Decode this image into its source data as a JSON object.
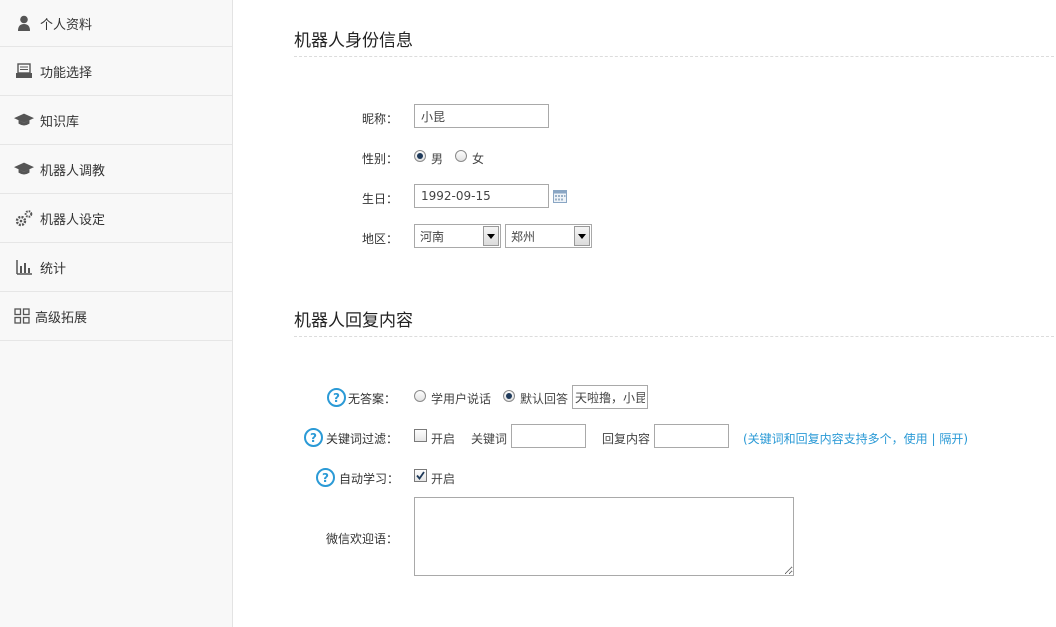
{
  "sidebar": {
    "items": [
      {
        "label": "个人资料",
        "icon": "user-icon"
      },
      {
        "label": "功能选择",
        "icon": "tray-icon"
      },
      {
        "label": "知识库",
        "icon": "graduation-cap-icon"
      },
      {
        "label": "机器人调教",
        "icon": "graduation-cap-icon"
      },
      {
        "label": "机器人设定",
        "icon": "gears-icon"
      },
      {
        "label": "统计",
        "icon": "bar-chart-icon"
      },
      {
        "label": "高级拓展",
        "icon": "grid-icon"
      }
    ]
  },
  "identity": {
    "title": "机器人身份信息",
    "nickname_label": "昵称：",
    "nickname_value": "小昆",
    "gender_label": "性别：",
    "gender_male": "男",
    "gender_female": "女",
    "gender_selected": "男",
    "birthday_label": "生日：",
    "birthday_value": "1992-09-15",
    "region_label": "地区：",
    "province": "河南",
    "city": "郑州"
  },
  "reply": {
    "title": "机器人回复内容",
    "no_answer_label": "无答案：",
    "learn_user_option": "学用户说话",
    "default_reply_option": "默认回答",
    "default_reply_value": "天啦撸，小昆",
    "keyword_filter_label": "关键词过滤：",
    "keyword_filter_enable": "开启",
    "keyword_label": "关键词",
    "reply_content_label": "回复内容",
    "keyword_hint": "(关键词和回复内容支持多个，使用 | 隔开)",
    "auto_learn_label": "自动学习：",
    "auto_learn_enable": "开启",
    "auto_learn_checked": true,
    "wechat_welcome_label": "微信欢迎语："
  },
  "colors": {
    "accent": "#2b9ad6",
    "sidebar_bg": "#f8f8f8"
  }
}
